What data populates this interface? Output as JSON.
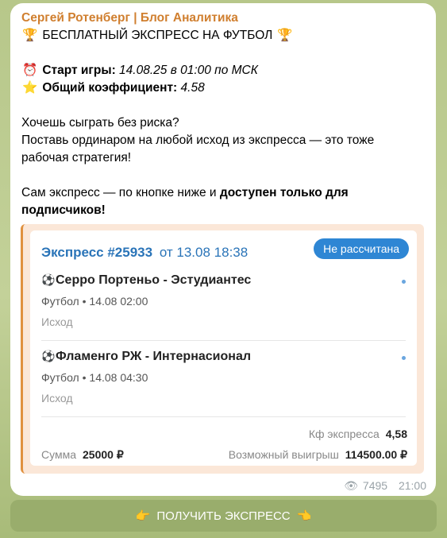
{
  "post": {
    "sender": "Сергей Ротенберг | Блог Аналитика",
    "headline": "БЕСПЛАТНЫЙ ЭКСПРЕСС НА ФУТБОЛ",
    "start_label": "Старт игры:",
    "start_value": "14.08.25 в 01:00 по МСК",
    "coef_label": "Общий коэффициент:",
    "coef_value": "4.58",
    "line1": "Хочешь сыграть без риска?",
    "line2": "Поставь ординаром на любой исход из экспресса — это тоже",
    "line3": "рабочая стратегия!",
    "line4_prefix": "Сам экспресс — по кнопке ниже и ",
    "line4_bold": "доступен только для",
    "line5_bold": "подписчиков!"
  },
  "card": {
    "title": "Экспресс #25933",
    "date": "от 13.08 18:38",
    "status": "Не рассчитана",
    "matches": [
      {
        "title": "Серро Портеньо - Эстудиантес",
        "meta": "Футбол • 14.08 02:00",
        "outcome": "Исход"
      },
      {
        "title": "Фламенго РЖ - Интернасионал",
        "meta": "Футбол • 14.08 04:30",
        "outcome": "Исход"
      }
    ],
    "kf_label": "Кф экспресса",
    "kf_value": "4,58",
    "sum_label": "Сумма",
    "sum_value": "25000 ₽",
    "win_label": "Возможный выигрыш",
    "win_value": "114500.00 ₽"
  },
  "footer": {
    "views": "7495",
    "time": "21:00"
  },
  "button": {
    "label": "ПОЛУЧИТЬ ЭКСПРЕСС"
  },
  "icons": [
    "trophy-icon",
    "alarm-clock-icon",
    "star-icon",
    "soccer-ball-icon",
    "eye-icon",
    "pointing-hand-icon"
  ]
}
